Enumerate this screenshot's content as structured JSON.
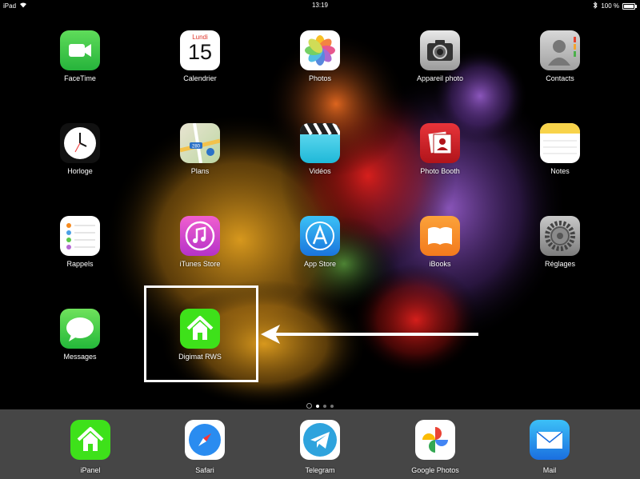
{
  "status_bar": {
    "device": "iPad",
    "time": "13:19",
    "battery_text": "100 %",
    "battery_level": 1.0
  },
  "calendar": {
    "weekday": "Lundi",
    "day": "15"
  },
  "apps": {
    "facetime": "FaceTime",
    "calendrier": "Calendrier",
    "photos": "Photos",
    "appareil_photo": "Appareil photo",
    "contacts": "Contacts",
    "horloge": "Horloge",
    "plans": "Plans",
    "videos": "Vidéos",
    "photo_booth": "Photo Booth",
    "notes": "Notes",
    "rappels": "Rappels",
    "itunes_store": "iTunes Store",
    "app_store": "App Store",
    "ibooks": "iBooks",
    "reglages": "Réglages",
    "messages": "Messages",
    "digimat": "Digimat RWS"
  },
  "dock": {
    "ipanel": "iPanel",
    "safari": "Safari",
    "telegram": "Telegram",
    "google_photos": "Google Photos",
    "mail": "Mail"
  },
  "plans_badge": "280",
  "icons": {
    "facetime": "video-camera-icon",
    "calendrier": "calendar-icon",
    "photos": "photos-flower-icon",
    "appareil_photo": "camera-icon",
    "contacts": "contact-silhouette-icon",
    "horloge": "clock-icon",
    "plans": "map-icon",
    "videos": "clapperboard-icon",
    "photo_booth": "photo-booth-icon",
    "notes": "notepad-icon",
    "rappels": "reminders-list-icon",
    "itunes_store": "music-note-icon",
    "app_store": "app-store-a-icon",
    "ibooks": "open-book-icon",
    "reglages": "gear-icon",
    "messages": "speech-bubble-icon",
    "digimat": "house-icon",
    "ipanel": "house-icon",
    "safari": "compass-icon",
    "telegram": "paper-plane-icon",
    "google_photos": "pinwheel-icon",
    "mail": "envelope-icon"
  },
  "colors": {
    "highlight": "#ffffff",
    "home_green": "#3ee11a",
    "dock_bg": "#5a5a5a"
  }
}
